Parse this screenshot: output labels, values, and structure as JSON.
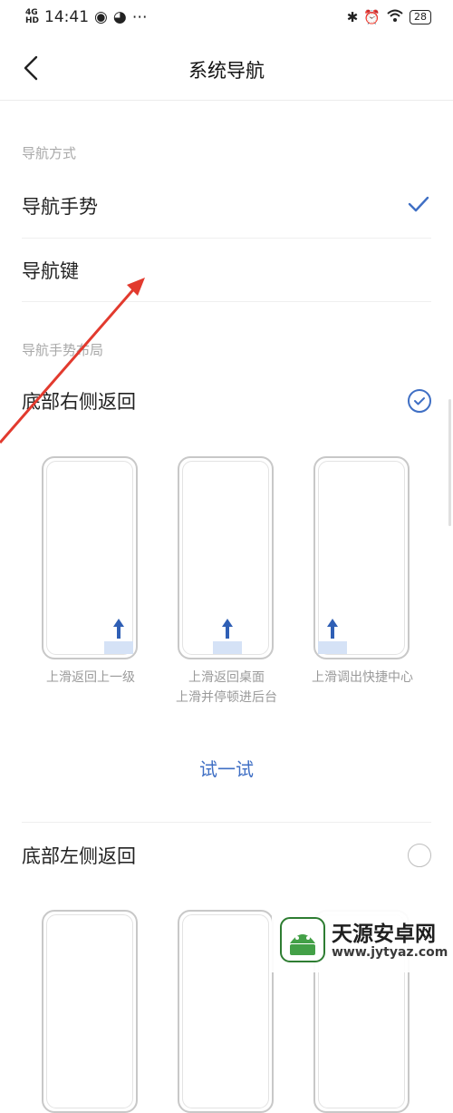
{
  "status_bar": {
    "network_top": "4G",
    "network_sub": "HD",
    "time": "14:41",
    "battery": "28"
  },
  "header": {
    "title": "系统导航"
  },
  "nav_method": {
    "section_label": "导航方式",
    "options": [
      {
        "label": "导航手势",
        "selected": true
      },
      {
        "label": "导航键",
        "selected": false
      }
    ]
  },
  "gesture_layout": {
    "section_label": "导航手势布局",
    "options": [
      {
        "label": "底部右侧返回",
        "selected": true,
        "captions": [
          "上滑返回上一级",
          "上滑返回桌面\n上滑并停顿进后台",
          "上滑调出快捷中心"
        ]
      },
      {
        "label": "底部左侧返回",
        "selected": false
      }
    ],
    "try_label": "试一试"
  },
  "colors": {
    "accent": "#3f6fc4",
    "annotation_arrow": "#e23a2e",
    "highlight": "#d5e2f6"
  },
  "watermark": {
    "name": "天源安卓网",
    "url": "www.jytyaz.com"
  }
}
